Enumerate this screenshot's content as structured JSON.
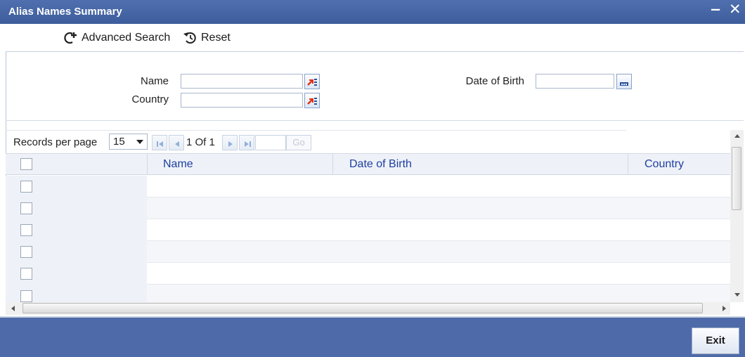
{
  "window": {
    "title": "Alias Names Summary",
    "minimize_glyph": "‒",
    "close_glyph": "✕"
  },
  "toolbar": {
    "advanced_search_label": "Advanced Search",
    "reset_label": "Reset"
  },
  "search": {
    "name_label": "Name",
    "name_value": "",
    "country_label": "Country",
    "country_value": "",
    "dob_label": "Date of Birth",
    "dob_value": ""
  },
  "pager": {
    "records_per_page_label": "Records per page",
    "records_per_page_value": "15",
    "page_info": "1 Of 1",
    "go_label": "Go",
    "goto_value": ""
  },
  "grid": {
    "columns": [
      "Name",
      "Date of Birth",
      "Country"
    ],
    "rows": [
      {},
      {},
      {},
      {},
      {},
      {}
    ]
  },
  "footer": {
    "exit_label": "Exit"
  },
  "colors": {
    "titlebar": "#3d5d9c",
    "footer": "#4e6aa8",
    "column_header_text": "#1f3ea0"
  },
  "icons": [
    "advanced-search-icon",
    "reset-icon",
    "lov-icon",
    "calendar-icon",
    "first-page-icon",
    "prev-page-icon",
    "next-page-icon",
    "last-page-icon"
  ]
}
